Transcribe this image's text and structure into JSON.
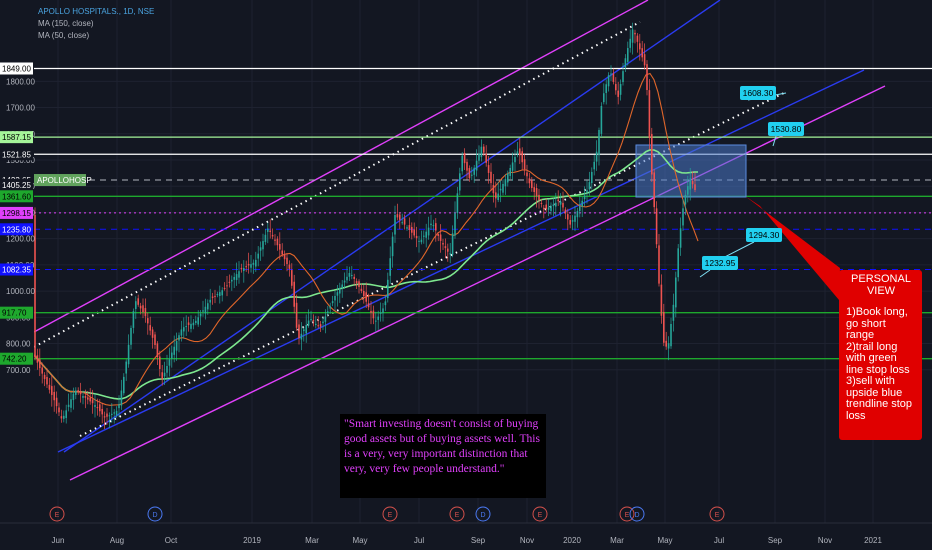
{
  "header": {
    "symbol_title": "APOLLO HOSPITALS., 1D, NSE",
    "ma150_label": "MA (150, close)",
    "ma50_label": "MA (50, close)"
  },
  "chart_data": {
    "type": "candlestick",
    "symbol": "APOLLOHOSP",
    "ylim": [
      680,
      1860
    ],
    "y_ticks": [
      700,
      800,
      900,
      1000,
      1100,
      1200,
      1300,
      1400,
      1500,
      1600,
      1700,
      1800
    ],
    "x_tick_labels": [
      "Jun",
      "Aug",
      "Oct",
      "2019",
      "Mar",
      "May",
      "Jul",
      "Sep",
      "Nov",
      "2020",
      "Mar",
      "May",
      "Jul",
      "Sep",
      "Nov",
      "2021"
    ],
    "price_scale_labels": [
      {
        "value": "1849.00",
        "bg": "#ffffff",
        "fg": "#000000"
      },
      {
        "value": "1587.15",
        "bg": "#a5f59a",
        "fg": "#000000"
      },
      {
        "value": "1521.85",
        "bg": "#131722",
        "fg": "#ffffff"
      },
      {
        "value": "1423.65",
        "bg": "#131722",
        "fg": "#ffffff"
      },
      {
        "value": "1405.25",
        "bg": "#131722",
        "fg": "#ffffff"
      },
      {
        "value": "1361.60",
        "bg": "#1ea82d",
        "fg": "#000000"
      },
      {
        "value": "1298.15",
        "bg": "#e040fb",
        "fg": "#000000"
      },
      {
        "value": "1235.80",
        "bg": "#1010ff",
        "fg": "#ffffff"
      },
      {
        "value": "1082.35",
        "bg": "#1010ff",
        "fg": "#ffffff"
      },
      {
        "value": "917.70",
        "bg": "#1ea82d",
        "fg": "#000000"
      },
      {
        "value": "742.20",
        "bg": "#1ea82d",
        "fg": "#000000"
      }
    ],
    "current_price_label": "APOLLOHOSP",
    "horizontal_levels": [
      {
        "value": 1849.0,
        "color": "#ffffff",
        "style": "solid"
      },
      {
        "value": 1587.15,
        "color": "#a5f59a",
        "style": "solid"
      },
      {
        "value": 1521.85,
        "color": "#ffffff",
        "style": "solid"
      },
      {
        "value": 1423.65,
        "color": "#b2b5be",
        "style": "dashed"
      },
      {
        "value": 1361.6,
        "color": "#1ea82d",
        "style": "solid"
      },
      {
        "value": 1298.15,
        "color": "#e040fb",
        "style": "dotted"
      },
      {
        "value": 1235.8,
        "color": "#1010ff",
        "style": "dashed"
      },
      {
        "value": 1082.35,
        "color": "#1010ff",
        "style": "dashed"
      },
      {
        "value": 917.7,
        "color": "#1ea82d",
        "style": "solid"
      },
      {
        "value": 742.2,
        "color": "#1ea82d",
        "style": "solid"
      }
    ],
    "price_callouts": [
      "1608.30",
      "1530.80",
      "1294.30",
      "1232.95"
    ],
    "event_markers": [
      "E",
      "D",
      "E",
      "E",
      "D",
      "E",
      "E",
      "D",
      "E"
    ],
    "series": [
      {
        "name": "MA (150, close)",
        "color": "#7ee88f"
      },
      {
        "name": "MA (50, close)",
        "color": "#e0662a"
      }
    ],
    "colors": {
      "up": "#26a69a",
      "down": "#ef5350",
      "channel_upper": "#e040fb",
      "channel_blue": "#2a3bf0",
      "box": "#4a78c8"
    }
  },
  "quote": "\"Smart investing doesn't consist of buying good assets but of buying assets well. This is a very, very important distinction that very, very few people understand.\"",
  "personal_view": {
    "heading": "PERSONAL VIEW",
    "lines": [
      "1)Book long, go short range",
      "2)trail long with green line stop loss",
      "3)sell with upside blue trendline stop loss"
    ]
  }
}
